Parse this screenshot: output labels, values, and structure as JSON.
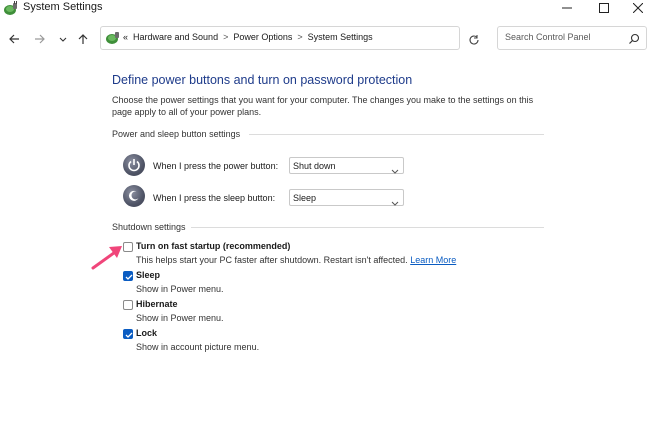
{
  "window": {
    "title": "System Settings"
  },
  "address": {
    "overflow": "«",
    "crumbs": [
      "Hardware and Sound",
      "Power Options",
      "System Settings"
    ],
    "separator": ">"
  },
  "search": {
    "placeholder": "Search Control Panel"
  },
  "page": {
    "title": "Define power buttons and turn on password protection",
    "description": "Choose the power settings that you want for your computer. The changes you make to the settings on this page apply to all of your power plans."
  },
  "power_section": {
    "header": "Power and sleep button settings",
    "rows": [
      {
        "label": "When I press the power button:",
        "value": "Shut down"
      },
      {
        "label": "When I press the sleep button:",
        "value": "Sleep"
      }
    ]
  },
  "shutdown_section": {
    "header": "Shutdown settings",
    "options": [
      {
        "label": "Turn on fast startup (recommended)",
        "description": "This helps start your PC faster after shutdown. Restart isn't affected.",
        "link": "Learn More",
        "checked": false
      },
      {
        "label": "Sleep",
        "description": "Show in Power menu.",
        "checked": true
      },
      {
        "label": "Hibernate",
        "description": "Show in Power menu.",
        "checked": false
      },
      {
        "label": "Lock",
        "description": "Show in account picture menu.",
        "checked": true
      }
    ]
  },
  "colors": {
    "title_blue": "#1e3b8a",
    "link_blue": "#0a5cc2",
    "checkbox_blue": "#0a5cc2",
    "annotation_arrow": "#f0457a"
  },
  "icons": {
    "app": "power-options-icon",
    "back": "arrow-left-icon",
    "forward": "arrow-right-icon",
    "recent": "chevron-down-icon",
    "up": "arrow-up-icon",
    "refresh": "refresh-icon",
    "search": "search-icon",
    "power_button": "power-button-icon",
    "sleep_button": "sleep-button-icon"
  }
}
